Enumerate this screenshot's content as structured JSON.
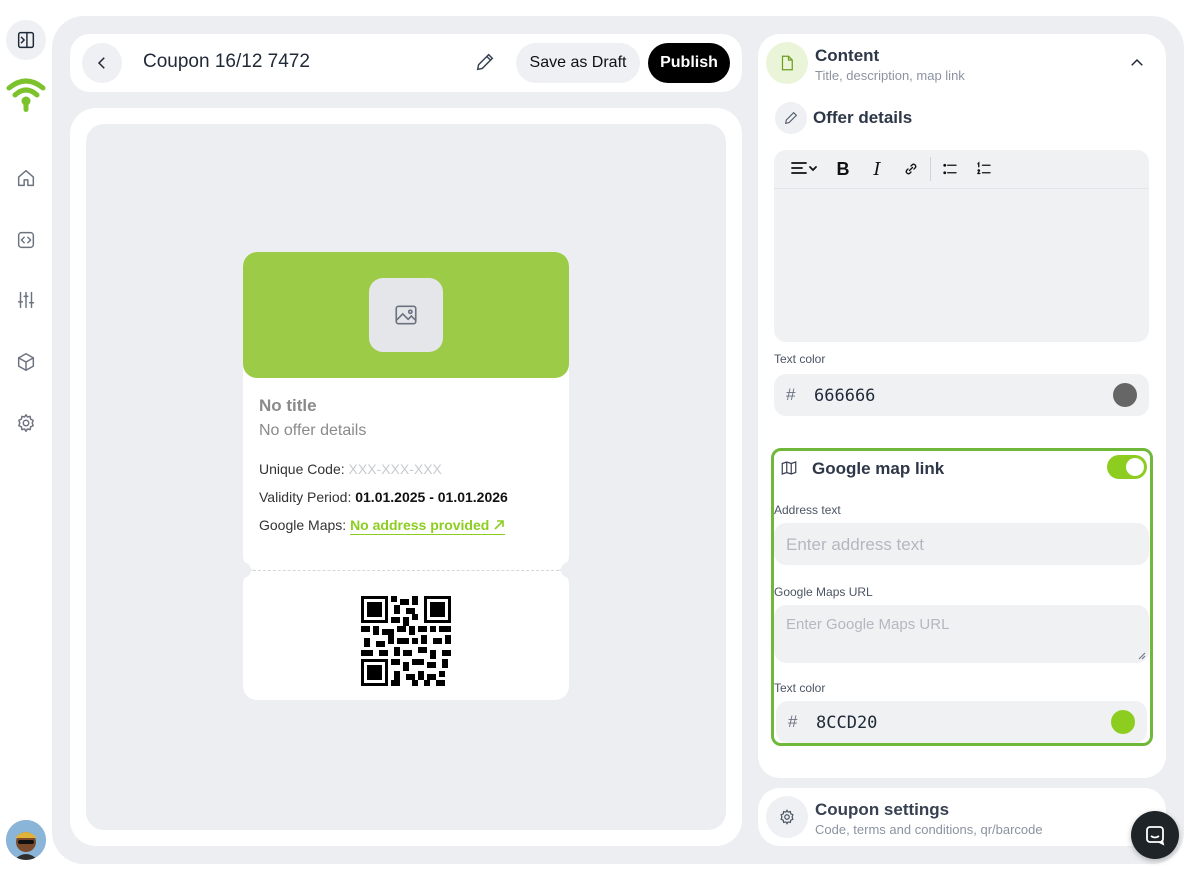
{
  "header": {
    "title": "Coupon 16/12 7472",
    "save_draft_label": "Save as Draft",
    "publish_label": "Publish"
  },
  "coupon": {
    "title": "No title",
    "details": "No offer details",
    "unique_code_label": "Unique Code:",
    "unique_code_value": "XXX-XXX-XXX",
    "validity_label": "Validity Period:",
    "validity_value": "01.01.2025 - 01.01.2026",
    "maps_label": "Google Maps:",
    "maps_value": "No address provided",
    "banner_color": "#9bcb47"
  },
  "content_section": {
    "title": "Content",
    "subtitle": "Title, description, map link",
    "offer_details_title": "Offer details",
    "text_color_label": "Text color",
    "text_color_hash": "#",
    "text_color_value": "666666",
    "text_color_swatch": "#666666"
  },
  "map_section": {
    "title": "Google map link",
    "enabled": true,
    "address_label": "Address text",
    "address_placeholder": "Enter address text",
    "url_label": "Google Maps URL",
    "url_placeholder": "Enter Google Maps URL",
    "text_color_label": "Text color",
    "text_color_hash": "#",
    "text_color_value": "8CCD20",
    "text_color_swatch": "#8CCD20"
  },
  "settings_section": {
    "title": "Coupon settings",
    "subtitle": "Code, terms and conditions, qr/barcode"
  },
  "colors": {
    "accent": "#8CCD20",
    "highlight_border": "#6FB83A"
  }
}
